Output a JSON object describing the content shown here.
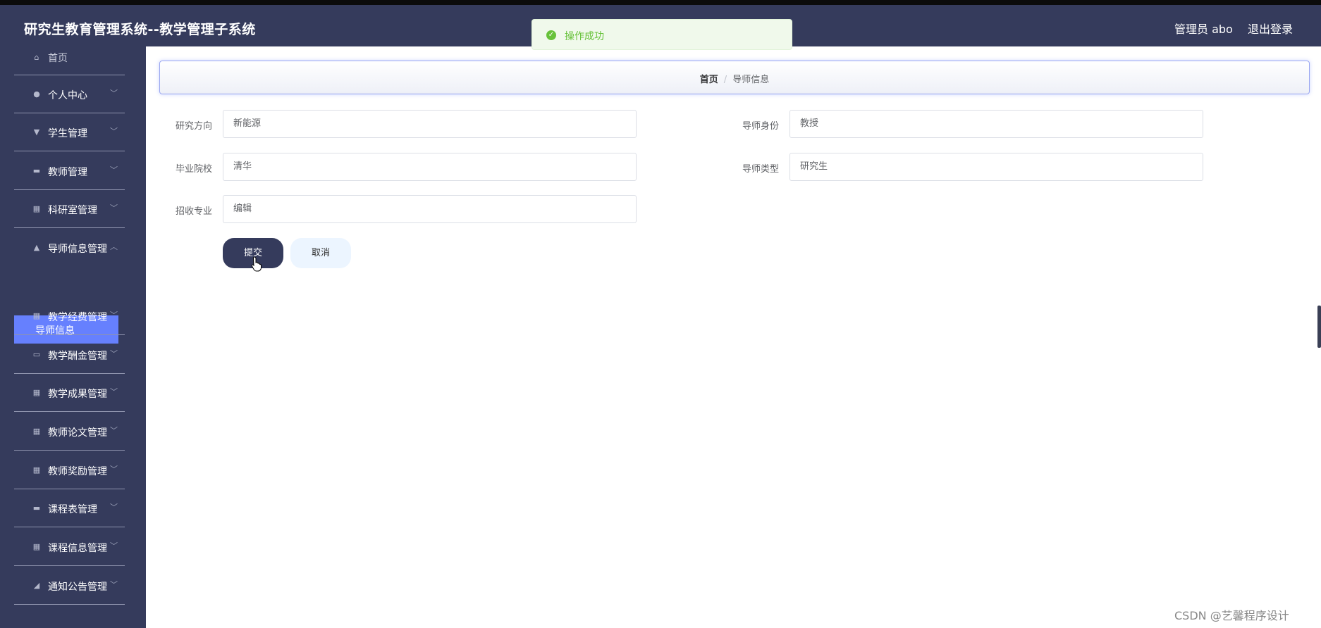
{
  "header": {
    "title": "研究生教育管理系统--教学管理子系统",
    "user": "管理员 abo",
    "logout": "退出登录"
  },
  "toast": {
    "message": "操作成功",
    "icon": "check-circle-icon"
  },
  "sidebar": {
    "items": [
      {
        "label": "首页",
        "icon": "home-icon"
      },
      {
        "label": "个人中心",
        "icon": "user-icon"
      },
      {
        "label": "学生管理",
        "icon": "student-icon"
      },
      {
        "label": "教师管理",
        "icon": "teacher-icon"
      },
      {
        "label": "科研室管理",
        "icon": "grid-icon"
      },
      {
        "label": "导师信息管理",
        "icon": "person-icon"
      },
      {
        "label": "教学经费管理",
        "icon": "grid-icon"
      },
      {
        "label": "教学酬金管理",
        "icon": "monitor-icon"
      },
      {
        "label": "教学成果管理",
        "icon": "grid-icon"
      },
      {
        "label": "教师论文管理",
        "icon": "grid-icon"
      },
      {
        "label": "教师奖励管理",
        "icon": "grid-icon"
      },
      {
        "label": "课程表管理",
        "icon": "chat-icon"
      },
      {
        "label": "课程信息管理",
        "icon": "grid-icon"
      },
      {
        "label": "通知公告管理",
        "icon": "notice-icon"
      }
    ],
    "active_sub": "导师信息"
  },
  "breadcrumb": {
    "home": "首页",
    "separator": "/",
    "current": "导师信息"
  },
  "form": {
    "research_direction": {
      "label": "研究方向",
      "value": "新能源"
    },
    "graduate_school": {
      "label": "毕业院校",
      "value": "清华"
    },
    "major": {
      "label": "招收专业",
      "value": "编辑"
    },
    "identity": {
      "label": "导师身份",
      "value": "教授"
    },
    "type": {
      "label": "导师类型",
      "value": "研究生"
    }
  },
  "buttons": {
    "submit": "提交",
    "cancel": "取消"
  },
  "watermark": "CSDN @艺馨程序设计",
  "colors": {
    "header_bg": "#353b5c",
    "sidebar_bg": "#353b5c",
    "active_item": "#6680fe",
    "success": "#67c23a"
  }
}
